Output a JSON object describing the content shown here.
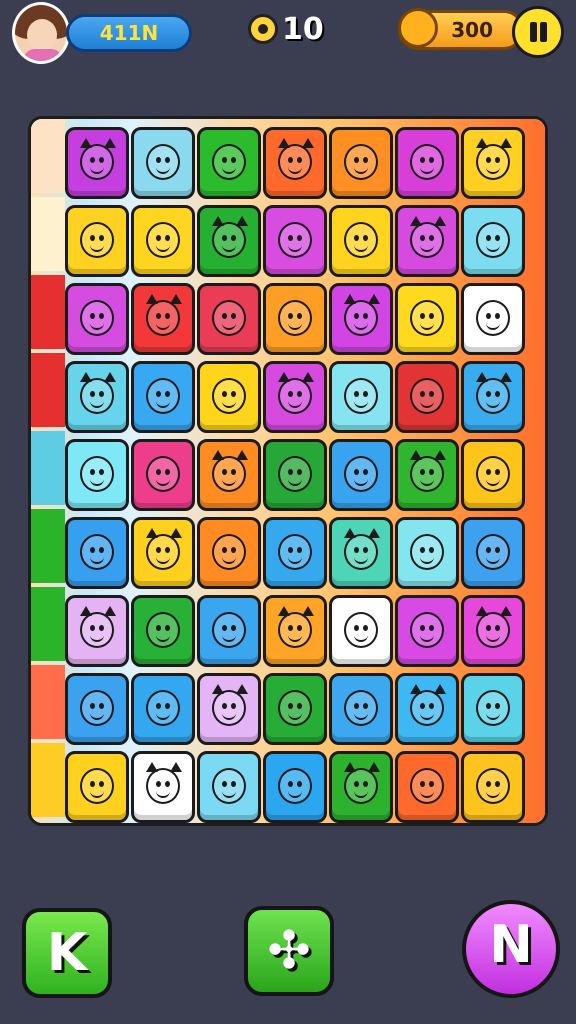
{
  "hud": {
    "player_score": "411N",
    "moves_count": "10",
    "coins": "300"
  },
  "icons": {
    "avatar": "avatar-icon",
    "gear": "gear-icon",
    "coin": "coin-icon",
    "pause": "pause-icon",
    "left_button": "k-icon",
    "middle_button": "shuffle-icon",
    "right_button": "cursor-icon"
  },
  "buttons": {
    "left_glyph": "K",
    "middle_glyph": "✣",
    "right_glyph": "N"
  },
  "board": {
    "rows": [
      [
        "#c53fe0",
        "#8ad9ef",
        "#2dbb2e",
        "#ff6a2c",
        "#ff8f22",
        "#d83fd8",
        "#ffcf21"
      ],
      [
        "#ffd120",
        "#ffd520",
        "#25b031",
        "#d84ce0",
        "#ffd31e",
        "#d64ae0",
        "#7cdcf0"
      ],
      [
        "#d54ce1",
        "#f23838",
        "#ea3c55",
        "#ff9e24",
        "#d244e4",
        "#ffd91f",
        "#ffffff"
      ],
      [
        "#66d4ea",
        "#38a8f2",
        "#ffd51c",
        "#d64ae0",
        "#86e3f0",
        "#e23434",
        "#38acef"
      ],
      [
        "#7ee8f6",
        "#ee3d8a",
        "#ff8c23",
        "#27a737",
        "#38a4ef",
        "#2fb52e",
        "#ffc419"
      ],
      [
        "#379ff0",
        "#ffd01d",
        "#ff8b22",
        "#36a9ee",
        "#4ed5b8",
        "#85e5ee",
        "#3ea1ef"
      ],
      [
        "#e3b3f3",
        "#28b037",
        "#39a6ef",
        "#ffa427",
        "#ffffff",
        "#d84ae4",
        "#e648da"
      ],
      [
        "#3ba2f0",
        "#33a8f1",
        "#e3b5f7",
        "#27ad35",
        "#3ca8f0",
        "#3eb8f2",
        "#5ad3e8"
      ],
      [
        "#ffd11f",
        "#ffffff",
        "#7cd9f3",
        "#2ba6f0",
        "#2db22e",
        "#ff6a2c",
        "#ffc31d"
      ]
    ],
    "sidebar": [
      "#fde2c6",
      "#fdf1d0",
      "#e63030",
      "#e63030",
      "#5ecce2",
      "#2bb42a",
      "#2bb42a",
      "#ff6d4a",
      "#ffcb25"
    ]
  }
}
